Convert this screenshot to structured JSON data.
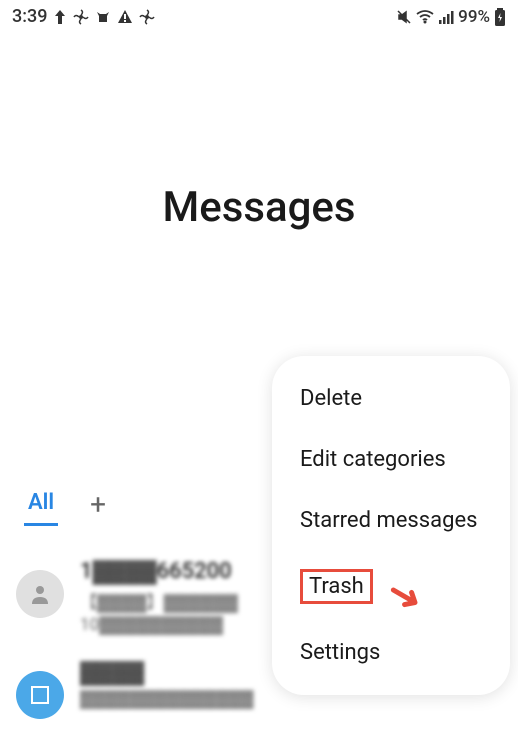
{
  "status_bar": {
    "time": "3:39",
    "battery": "99%"
  },
  "header": {
    "title": "Messages"
  },
  "tabs": {
    "all": "All"
  },
  "conversations": [
    {
      "title": "1▓▓▓▓665200",
      "preview": "【▓▓▓▓】▓▓▓▓▓▓",
      "meta": "10▓▓▓▓▓▓▓▓▓▓"
    },
    {
      "title": "▓▓▓▓",
      "preview": "▓▓▓▓▓▓▓▓▓▓▓▓▓▓"
    }
  ],
  "menu": {
    "items": [
      "Delete",
      "Edit categories",
      "Starred messages",
      "Trash",
      "Settings"
    ]
  }
}
